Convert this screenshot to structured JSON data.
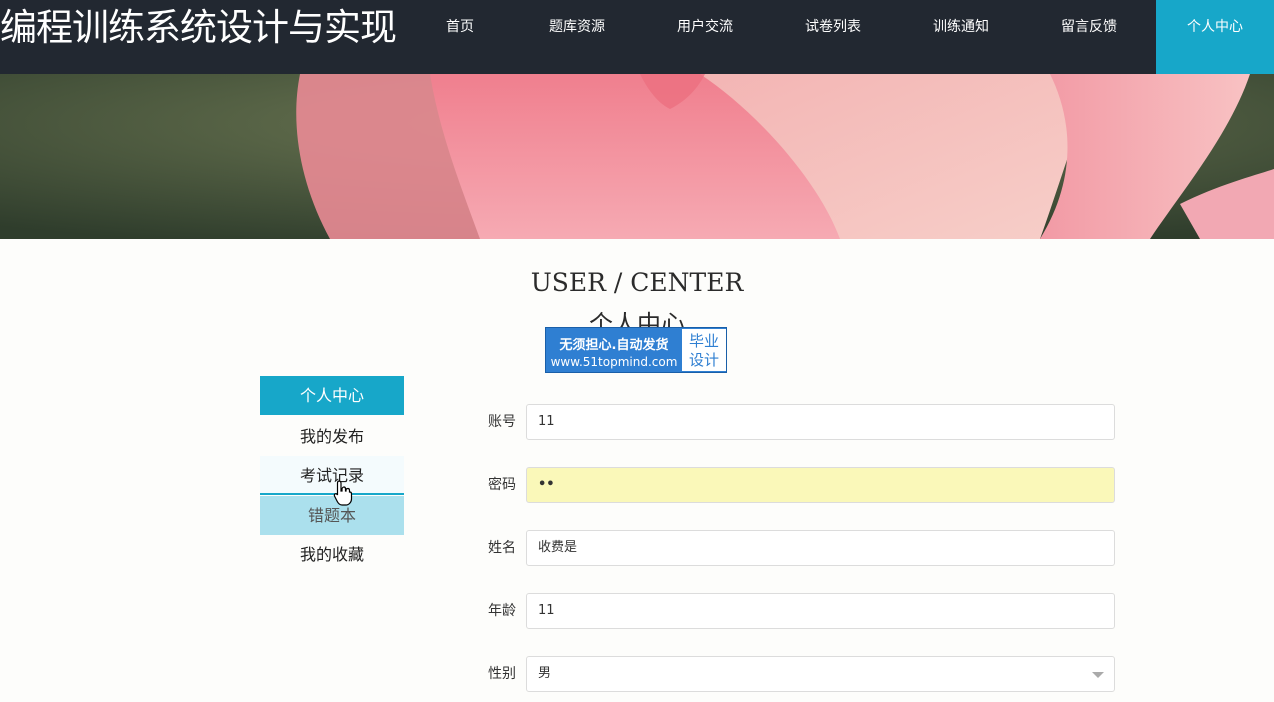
{
  "site": {
    "title": "编程训练系统设计与实现"
  },
  "nav": {
    "items": [
      {
        "label": "首页"
      },
      {
        "label": "题库资源"
      },
      {
        "label": "用户交流"
      },
      {
        "label": "试卷列表"
      },
      {
        "label": "训练通知"
      },
      {
        "label": "留言反馈"
      },
      {
        "label": "个人中心",
        "active": true
      }
    ]
  },
  "heading": {
    "en": "USER / CENTER",
    "cn": "个人中心"
  },
  "stamp": {
    "line1": "无须担心.自动发货",
    "line2": "www.51topmind.com",
    "right1": "毕业",
    "right2": "设计"
  },
  "side_menu": {
    "items": [
      {
        "label": "个人中心",
        "state": "active"
      },
      {
        "label": "我的发布",
        "state": "normal"
      },
      {
        "label": "考试记录",
        "state": "hover"
      },
      {
        "label": "错题本",
        "state": "light"
      },
      {
        "label": "我的收藏",
        "state": "normal"
      }
    ]
  },
  "form": {
    "account": {
      "label": "账号",
      "value": "11"
    },
    "password": {
      "label": "密码",
      "value": "••"
    },
    "name": {
      "label": "姓名",
      "value": "收费是"
    },
    "age": {
      "label": "年龄",
      "value": "11"
    },
    "gender": {
      "label": "性别",
      "value": "男"
    }
  },
  "colors": {
    "nav_bg": "#222831",
    "accent": "#17a7c9",
    "password_bg": "#faf8b9"
  }
}
